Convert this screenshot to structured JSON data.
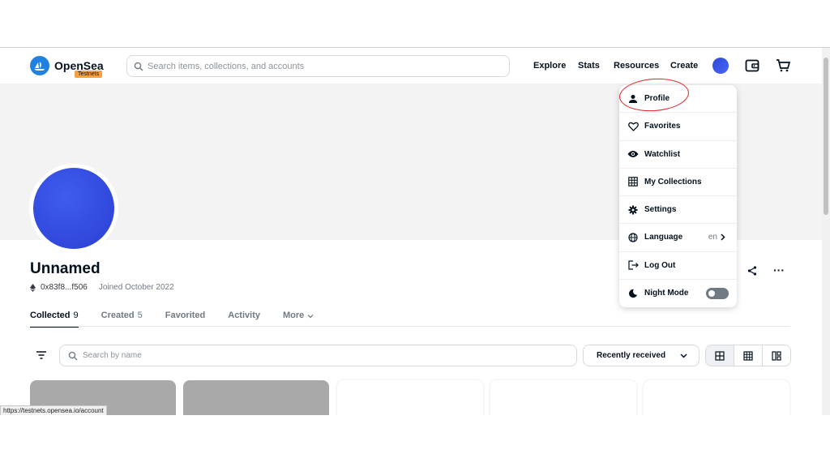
{
  "header": {
    "brand": "OpenSea",
    "badge": "Testnets",
    "search_placeholder": "Search items, collections, and accounts",
    "nav": [
      "Explore",
      "Stats",
      "Resources",
      "Create"
    ]
  },
  "profile": {
    "name": "Unnamed",
    "address": "0x83f8...f506",
    "joined": "Joined October 2022"
  },
  "tabs": [
    {
      "label": "Collected",
      "count": "9"
    },
    {
      "label": "Created",
      "count": "5"
    },
    {
      "label": "Favorited",
      "count": ""
    },
    {
      "label": "Activity",
      "count": ""
    },
    {
      "label": "More",
      "count": ""
    }
  ],
  "filters": {
    "search_placeholder": "Search by name",
    "sort": "Recently received"
  },
  "menu": {
    "items": [
      "Profile",
      "Favorites",
      "Watchlist",
      "My Collections",
      "Settings",
      "Language",
      "Log Out",
      "Night Mode"
    ],
    "language_value": "en"
  },
  "status_url": "https://testnets.opensea.io/account",
  "colors": {
    "brand": "#2081e2",
    "badge": "#f6a040",
    "annotation": "#e02424"
  }
}
